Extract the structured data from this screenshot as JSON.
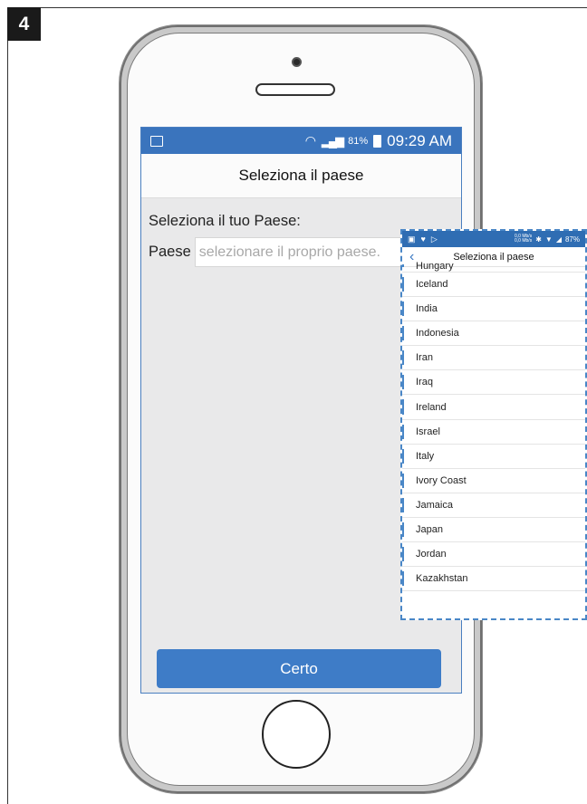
{
  "step_number": "4",
  "app": {
    "status_bar": {
      "battery_percent": "81%",
      "time": "09:29 AM",
      "icons": [
        "gallery-icon",
        "wifi-icon",
        "signal-icon",
        "battery-icon"
      ]
    },
    "title": "Seleziona il paese",
    "heading": "Seleziona il tuo Paese:",
    "country_label": "Paese",
    "country_placeholder": "selezionare il proprio paese.",
    "ok_button_label": "Certo"
  },
  "country_list": {
    "status_bar": {
      "net_up": "0,0 Mb/s",
      "net_down": "0,0 Mb/s",
      "battery_percent": "87%"
    },
    "title": "Seleziona il paese",
    "items": [
      "Hungary",
      "Iceland",
      "India",
      "Indonesia",
      "Iran",
      "Iraq",
      "Ireland",
      "Israel",
      "Italy",
      "Ivory Coast",
      "Jamaica",
      "Japan",
      "Jordan",
      "Kazakhstan"
    ]
  },
  "colors": {
    "status_bar_blue": "#3a74bd",
    "button_blue": "#3e7cc7",
    "dashed_border": "#4a87c7"
  }
}
